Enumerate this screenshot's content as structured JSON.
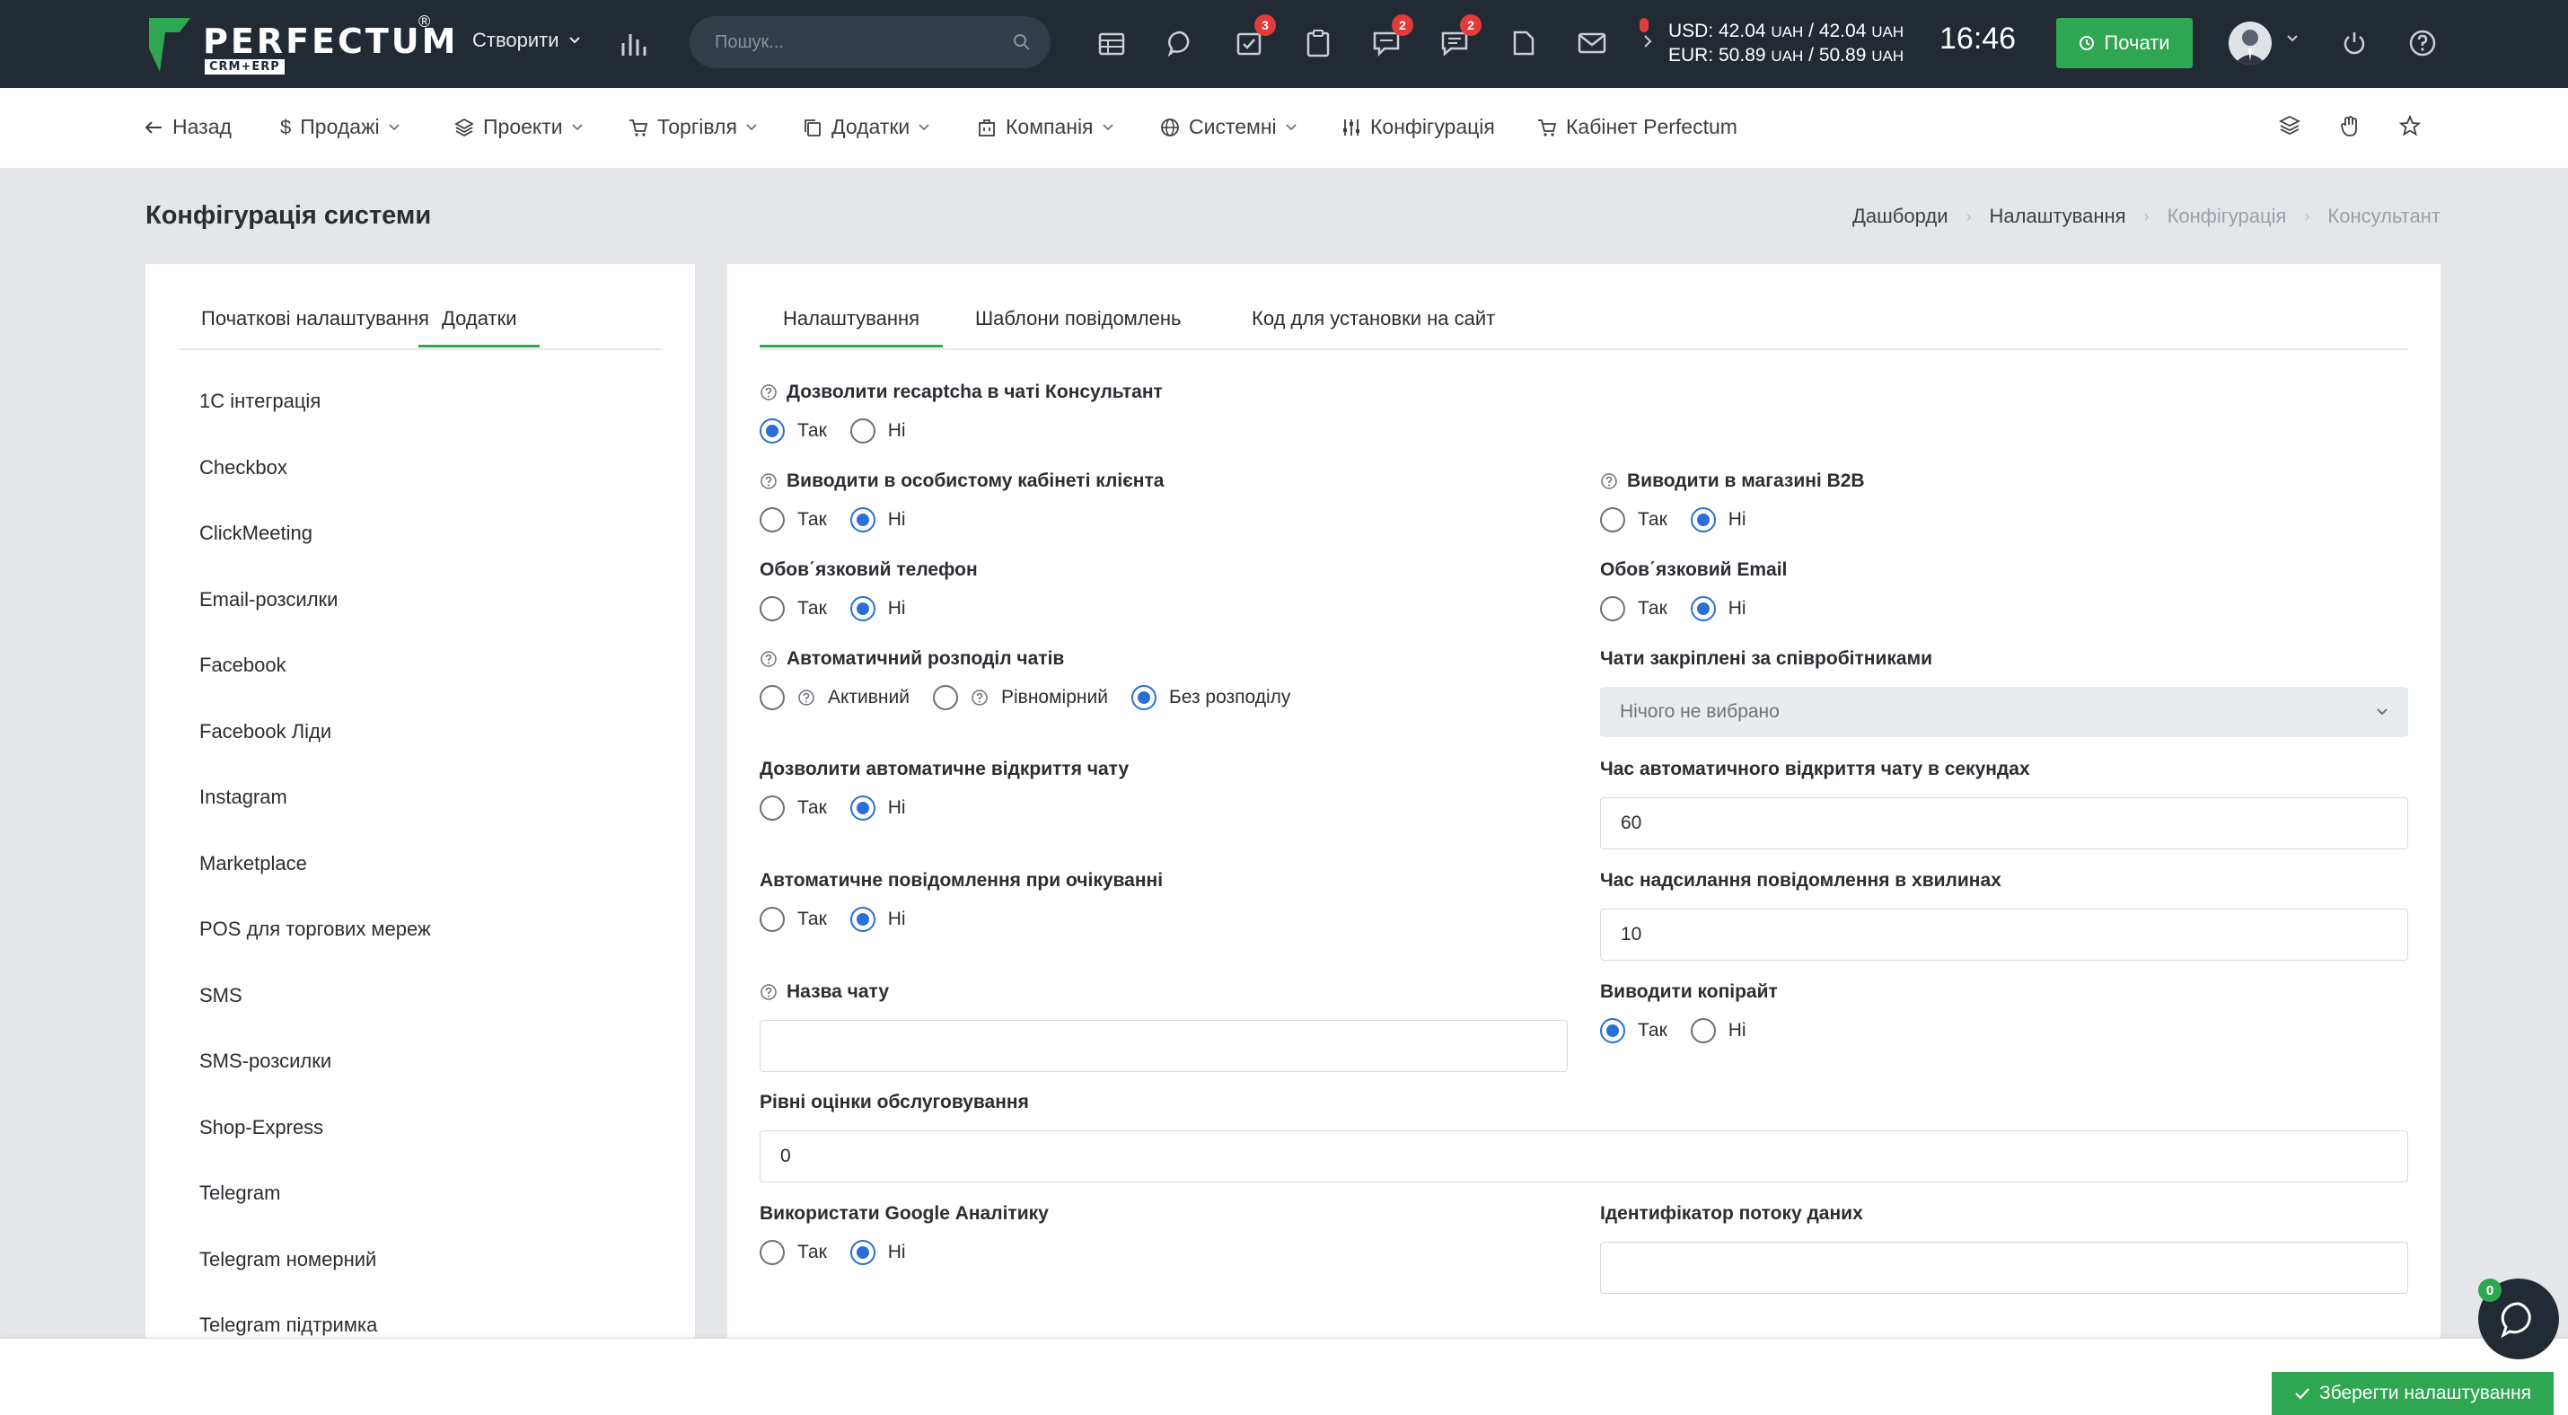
{
  "brand": {
    "name": "PERFECTUM",
    "reg": "®",
    "sub": "CRM+ERP"
  },
  "topbar": {
    "create_label": "Створити",
    "search_placeholder": "Пошук...",
    "badges": {
      "tasks": "3",
      "chat": "2",
      "messages": "2"
    },
    "currency_usd": "USD: 42.04",
    "currency_usd_unit1": "UAH",
    "currency_usd_sep": " / 42.04 ",
    "currency_usd_unit2": "UAH",
    "currency_eur": "EUR: 50.89",
    "currency_eur_unit1": "UAH",
    "currency_eur_sep": " / 50.89 ",
    "currency_eur_unit2": "UAH",
    "time": "16:46",
    "start_label": "Почати"
  },
  "subnav": {
    "back": "Назад",
    "sales": "Продажі",
    "projects": "Проекти",
    "trade": "Торгівля",
    "addons": "Додатки",
    "company": "Компанія",
    "system": "Системні",
    "config": "Конфігурація",
    "cabinet": "Кабінет Perfectum"
  },
  "page": {
    "title": "Конфігурація системи",
    "breadcrumbs": [
      "Дашборди",
      "Налаштування",
      "Конфігурація",
      "Консультант"
    ]
  },
  "left": {
    "tabs": [
      "Початкові налаштування",
      "Додатки"
    ],
    "items": [
      "1С інтеграція",
      "Checkbox",
      "ClickMeeting",
      "Email-розсилки",
      "Facebook",
      "Facebook Ліди",
      "Instagram",
      "Marketplace",
      "POS для торгових мереж",
      "SMS",
      "SMS-розсилки",
      "Shop-Express",
      "Telegram",
      "Telegram номерний",
      "Telegram підтримка"
    ]
  },
  "right": {
    "tabs": [
      "Налаштування",
      "Шаблони повідомлень",
      "Код для установки на сайт"
    ],
    "yes": "Так",
    "no": "Ні",
    "recaptcha_label": "Дозволити recaptcha в чаті Консультант",
    "cabinet_label": "Виводити в особистому кабінеті клієнта",
    "b2b_label": "Виводити в магазині B2B",
    "phone_label": "Обов΄язковий телефон",
    "email_label": "Обов΄язковий Email",
    "distribution_label": "Автоматичний розподіл чатів",
    "dist_active": "Активний",
    "dist_even": "Рівномірний",
    "dist_none": "Без розподілу",
    "assigned_label": "Чати закріплені за співробітниками",
    "assigned_value": "Нічого не вибрано",
    "autoopen_label": "Дозволити автоматичне відкриття чату",
    "autoopen_time_label": "Час автоматичного відкриття чату в секундах",
    "autoopen_time_value": "60",
    "automsg_label": "Автоматичне повідомлення при очікуванні",
    "automsg_time_label": "Час надсилання повідомлення в хвилинах",
    "automsg_time_value": "10",
    "chatname_label": "Назва чату",
    "chatname_value": "",
    "copyright_label": "Виводити копірайт",
    "rating_label": "Рівні оцінки обслуговування",
    "rating_value": "0",
    "ga_label": "Використати Google Аналітику",
    "stream_label": "Ідентифікатор потоку даних",
    "stream_value": ""
  },
  "footer": {
    "save_label": "Зберегти налаштування",
    "chat_count": "0"
  },
  "colors": {
    "topbar": "#222b33",
    "accent": "#2fa651",
    "radio": "#2a6fd6",
    "badge": "#e23b3b"
  }
}
